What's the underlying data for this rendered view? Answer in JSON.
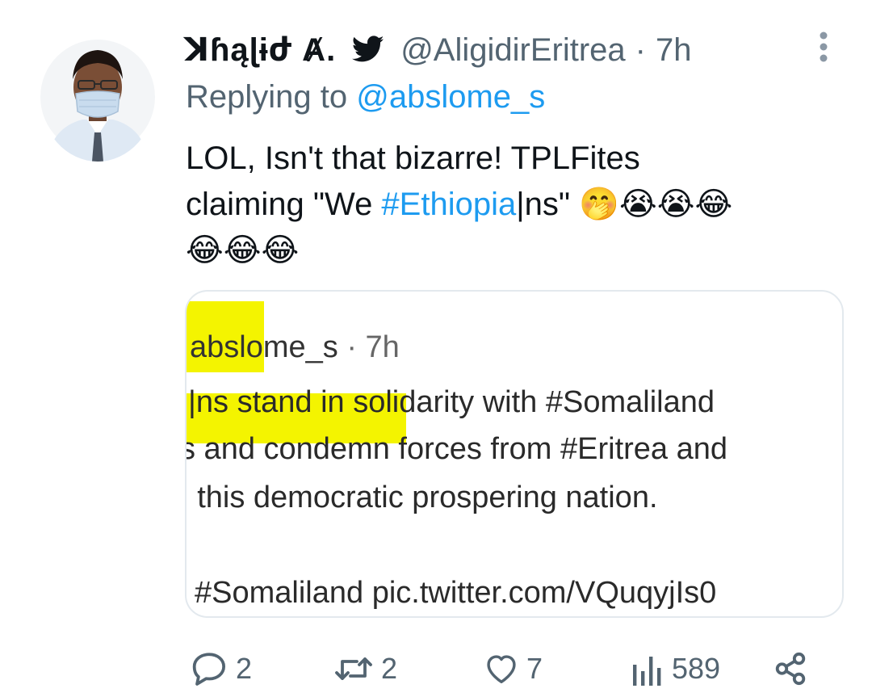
{
  "tweet": {
    "author_name": "ꓘɦąɭɨժ Ⱥ.",
    "handle": "@AligidirEritrea",
    "separator": "·",
    "time": "7h",
    "reply_prefix": "Replying to ",
    "reply_to": "@abslome_s",
    "text_line1": "LOL, Isn't that bizarre!  TPLFites",
    "text_line2_prefix": "claiming \"We ",
    "text_hashtag": "#Ethiopia",
    "text_line2_suffix": "|ns\" ",
    "emojis_line2": "🤭😭😭😂",
    "emojis_line3": "😂😂😂"
  },
  "quote": {
    "user": "abslome_s",
    "separator": "·",
    "time": "7h",
    "line1": "|ns  stand in solidarity with #Somaliland",
    "line2": "s and condemn forces from #Eritrea and",
    "line3": "· this democratic prospering nation.",
    "line4": "#Somaliland pic.twitter.com/VQuqyjIs0"
  },
  "actions": {
    "replies": "2",
    "retweets": "2",
    "likes": "7",
    "views": "589"
  },
  "icons": {
    "verified": "twitter-bird-icon",
    "more": "more-vertical-icon",
    "reply": "reply-bubble-icon",
    "retweet": "retweet-icon",
    "like": "heart-icon",
    "views": "analytics-bars-icon",
    "share": "share-icon"
  },
  "colors": {
    "link": "#1d9bf0",
    "secondary_text": "#536471",
    "highlight": "#f4f400"
  }
}
